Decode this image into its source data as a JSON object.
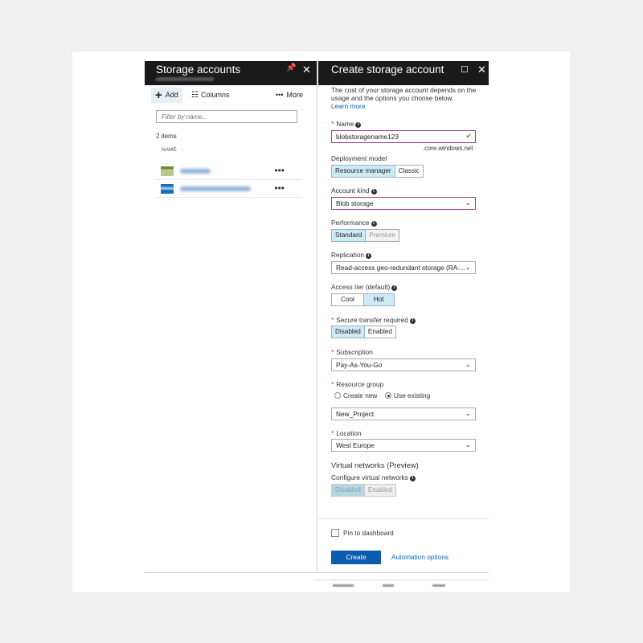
{
  "left_blade": {
    "title": "Storage accounts",
    "toolbar": {
      "add": "Add",
      "columns": "Columns",
      "more": "More"
    },
    "filter_placeholder": "Filter by name...",
    "count": "2 items",
    "column_header": "NAME",
    "sort_glyph": "↑↓",
    "more_glyph": "•••"
  },
  "right_blade": {
    "title": "Create storage account",
    "intro": "The cost of your storage account depends on the usage and the options you choose below.",
    "learn_more": "Learn more",
    "name": {
      "label": "Name",
      "value": "blobstoragename123",
      "suffix": ".core.windows.net"
    },
    "deployment_model": {
      "label": "Deployment model",
      "options": [
        "Resource manager",
        "Classic"
      ],
      "selected": "Resource manager"
    },
    "account_kind": {
      "label": "Account kind",
      "value": "Blob storage"
    },
    "performance": {
      "label": "Performance",
      "options": [
        "Standard",
        "Premium"
      ],
      "selected": "Standard"
    },
    "replication": {
      "label": "Replication",
      "value": "Read-access geo-redundant storage (RA-..."
    },
    "access_tier": {
      "label": "Access tier (default)",
      "options": [
        "Cool",
        "Hot"
      ],
      "selected": "Hot"
    },
    "secure_transfer": {
      "label": "Secure transfer required",
      "options": [
        "Disabled",
        "Enabled"
      ],
      "selected": "Disabled"
    },
    "subscription": {
      "label": "Subscription",
      "value": "Pay-As-You-Go"
    },
    "resource_group": {
      "label": "Resource group",
      "create_new": "Create new",
      "use_existing": "Use existing",
      "value": "New_Project"
    },
    "location": {
      "label": "Location",
      "value": "West Europe"
    },
    "vnet": {
      "heading": "Virtual networks (Preview)",
      "label": "Configure virtual networks",
      "options": [
        "Disabled",
        "Enabled"
      ],
      "selected": "Disabled"
    },
    "pin_label": "Pin to dashboard",
    "create_label": "Create",
    "automation_label": "Automation options"
  },
  "glyphs": {
    "pin": "📌",
    "close": "✕",
    "maximize": "☐",
    "chevron": "⌄",
    "check": "✔",
    "info": "i",
    "plus": "+",
    "columns": "☷"
  },
  "colors": {
    "header_bg": "#1a1a1a",
    "accent": "#0b5cad",
    "selected_segment": "#d0eaf5",
    "active_border": "#a13f8b"
  }
}
